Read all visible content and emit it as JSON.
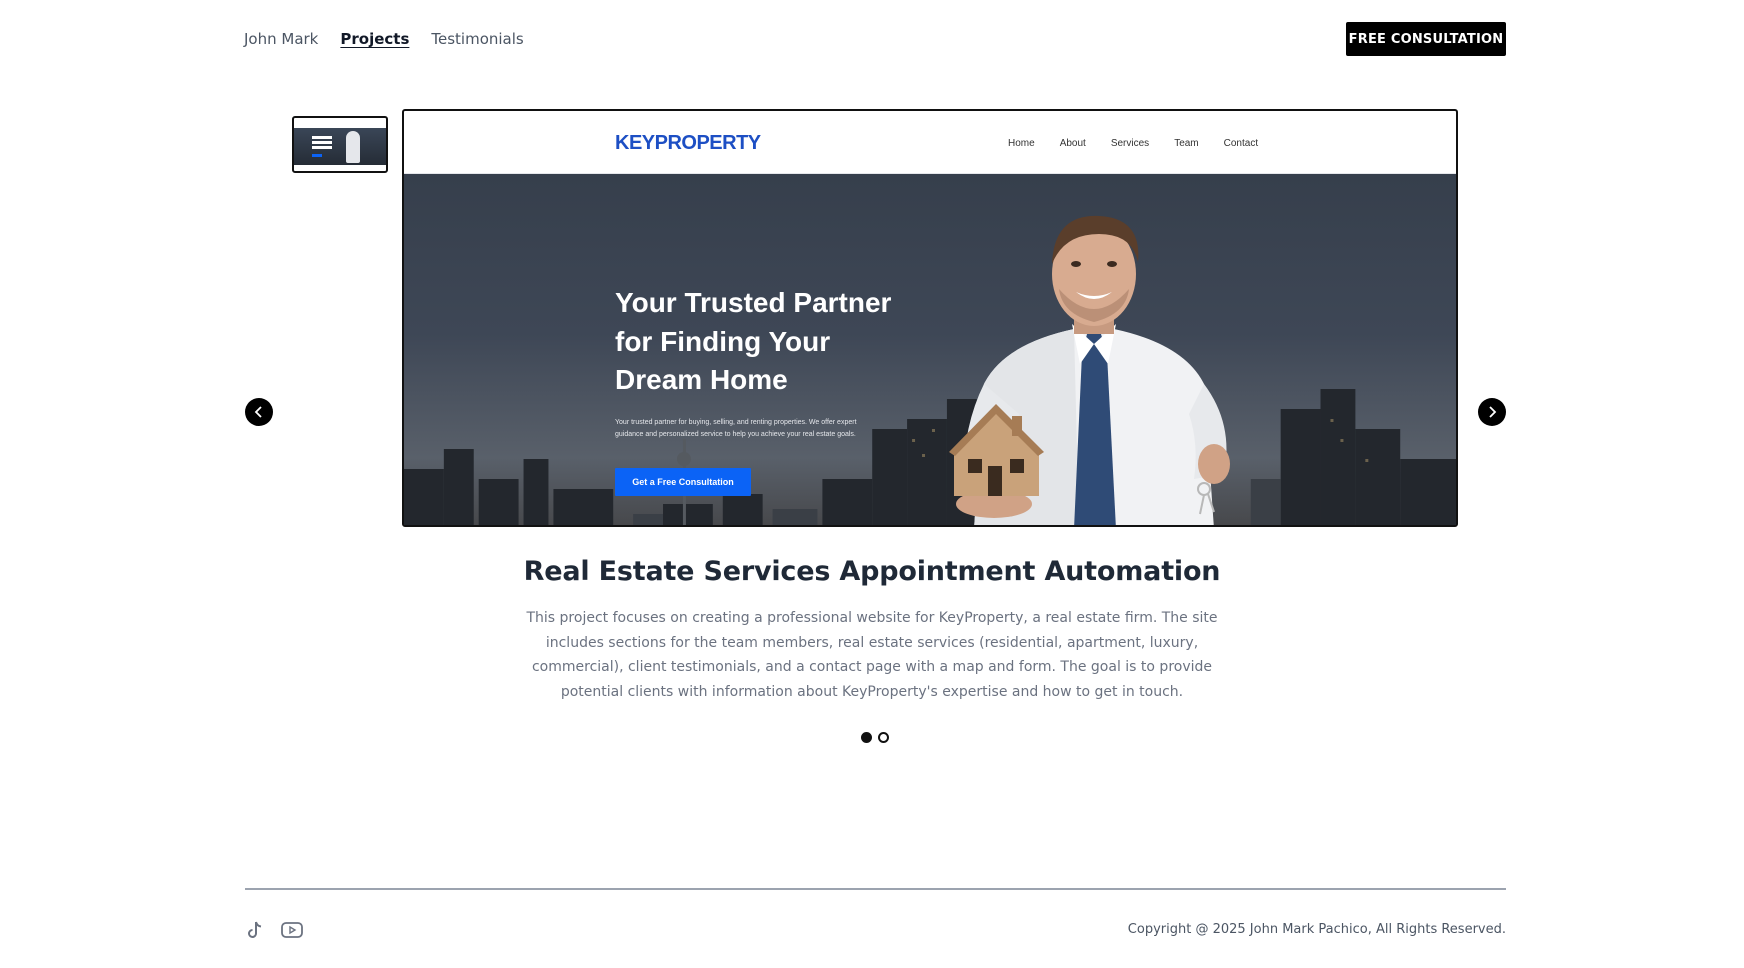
{
  "header": {
    "nav": [
      {
        "label": "John Mark",
        "active": false
      },
      {
        "label": "Projects",
        "active": true
      },
      {
        "label": "Testimonials",
        "active": false
      }
    ],
    "cta_label": "FREE CONSULTATION"
  },
  "carousel": {
    "slide": {
      "site_logo": "KEYPROPERTY",
      "site_nav": [
        "Home",
        "About",
        "Services",
        "Team",
        "Contact"
      ],
      "hero_title": "Your Trusted Partner for Finding Your Dream Home",
      "hero_subtitle": "Your trusted partner for buying, selling, and renting properties. We offer expert guidance and personalized service to help you achieve your real estate goals.",
      "hero_button": "Get a Free Consultation"
    },
    "prev_icon": "chevron-left-icon",
    "next_icon": "chevron-right-icon",
    "slide_count": 2,
    "active_index": 0
  },
  "project": {
    "title": "Real Estate Services Appointment Automation",
    "description": "This project focuses on creating a professional website for KeyProperty, a real estate firm. The site includes sections for the team members, real estate services (residential, apartment, luxury, commercial), client testimonials, and a contact page with a map and form. The goal is to provide potential clients with information about KeyProperty's expertise and how to get in touch."
  },
  "footer": {
    "social_icons": [
      "tiktok-icon",
      "youtube-icon"
    ],
    "copyright": "Copyright @ 2025 John Mark Pachico, All Rights Reserved."
  },
  "colors": {
    "accent_blue": "#0b63f6",
    "logo_blue": "#1d4fc4",
    "black": "#000000"
  }
}
